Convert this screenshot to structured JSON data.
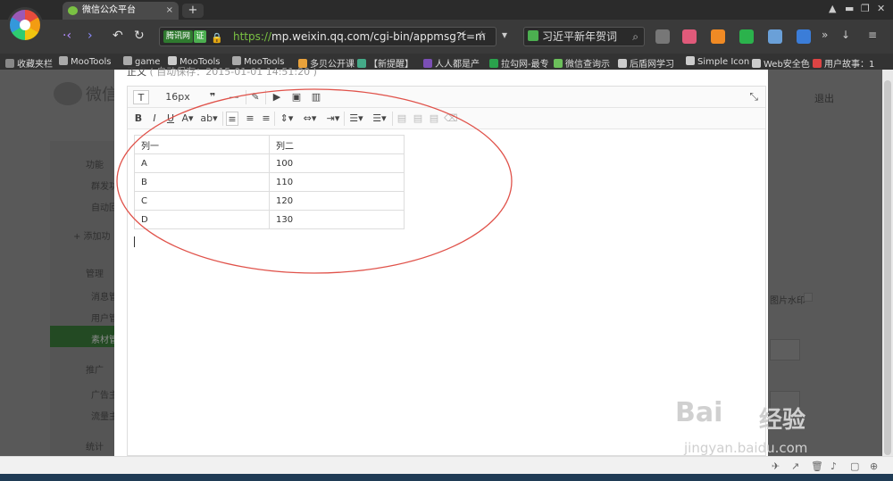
{
  "browser": {
    "tab_title": "微信公众平台",
    "tab_close": "×",
    "new_tab": "+",
    "address_tag": "腾讯网",
    "address_cert": "证",
    "address_scheme": "https://",
    "address_rest": "mp.weixin.qq.com/cgi-bin/appmsg?t=m ",
    "search_text": "习近平新年贺词",
    "bookmarks": [
      "收藏夹栏",
      "MooTools",
      "game",
      "MooTools",
      "MooTools",
      "多贝公开课",
      "【新提醒】",
      "人人都是产",
      "拉勾网-最专",
      "微信查询示",
      "后盾网学习",
      "Simple Icon",
      "Web安全色",
      "用户故事：1"
    ]
  },
  "background_page": {
    "logo": "微信",
    "logout": "退出",
    "section_function": "功能",
    "item_1": "群发功",
    "item_2": "自动回",
    "add_plugin": "+ 添加功",
    "section_manage": "管理",
    "manage_items": [
      "消息管",
      "用户管",
      "素材管"
    ],
    "section_promo": "推广",
    "promo_items": [
      "广告主",
      "流量主"
    ],
    "section_stats": "统计",
    "watermark_opt": "图片水印"
  },
  "editor": {
    "heading": "正文",
    "autosave": "( 自动保存：2015-01-01 14:51:20 )",
    "font_size": "16px",
    "table": {
      "headers": [
        "列一",
        "列二"
      ],
      "rows": [
        [
          "A",
          "100"
        ],
        [
          "B",
          "110"
        ],
        [
          "C",
          "120"
        ],
        [
          "D",
          "130"
        ]
      ]
    }
  },
  "watermark": {
    "brand_a": "Bai",
    "brand_b": "经验",
    "url": "jingyan.baidu.com"
  },
  "colors": {
    "annotation": "#e0524a",
    "active_menu": "#234a23"
  }
}
